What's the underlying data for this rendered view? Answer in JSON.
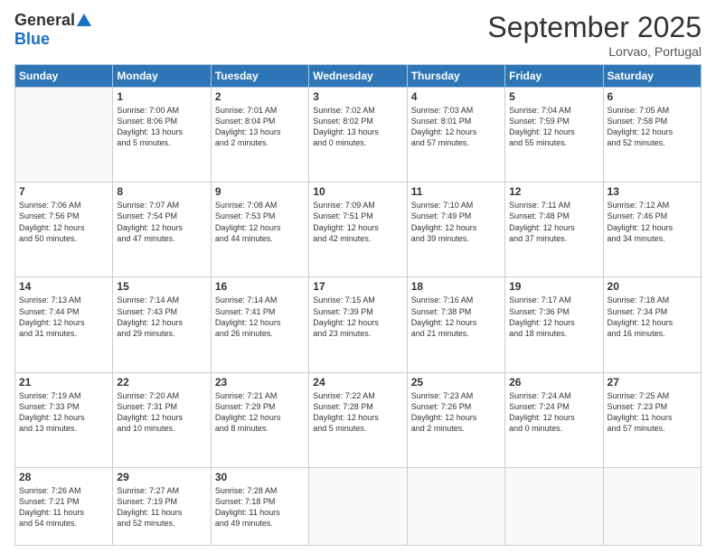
{
  "logo": {
    "general": "General",
    "blue": "Blue"
  },
  "title": "September 2025",
  "location": "Lorvao, Portugal",
  "days_header": [
    "Sunday",
    "Monday",
    "Tuesday",
    "Wednesday",
    "Thursday",
    "Friday",
    "Saturday"
  ],
  "weeks": [
    [
      {
        "day": "",
        "content": ""
      },
      {
        "day": "1",
        "content": "Sunrise: 7:00 AM\nSunset: 8:06 PM\nDaylight: 13 hours\nand 5 minutes."
      },
      {
        "day": "2",
        "content": "Sunrise: 7:01 AM\nSunset: 8:04 PM\nDaylight: 13 hours\nand 2 minutes."
      },
      {
        "day": "3",
        "content": "Sunrise: 7:02 AM\nSunset: 8:02 PM\nDaylight: 13 hours\nand 0 minutes."
      },
      {
        "day": "4",
        "content": "Sunrise: 7:03 AM\nSunset: 8:01 PM\nDaylight: 12 hours\nand 57 minutes."
      },
      {
        "day": "5",
        "content": "Sunrise: 7:04 AM\nSunset: 7:59 PM\nDaylight: 12 hours\nand 55 minutes."
      },
      {
        "day": "6",
        "content": "Sunrise: 7:05 AM\nSunset: 7:58 PM\nDaylight: 12 hours\nand 52 minutes."
      }
    ],
    [
      {
        "day": "7",
        "content": "Sunrise: 7:06 AM\nSunset: 7:56 PM\nDaylight: 12 hours\nand 50 minutes."
      },
      {
        "day": "8",
        "content": "Sunrise: 7:07 AM\nSunset: 7:54 PM\nDaylight: 12 hours\nand 47 minutes."
      },
      {
        "day": "9",
        "content": "Sunrise: 7:08 AM\nSunset: 7:53 PM\nDaylight: 12 hours\nand 44 minutes."
      },
      {
        "day": "10",
        "content": "Sunrise: 7:09 AM\nSunset: 7:51 PM\nDaylight: 12 hours\nand 42 minutes."
      },
      {
        "day": "11",
        "content": "Sunrise: 7:10 AM\nSunset: 7:49 PM\nDaylight: 12 hours\nand 39 minutes."
      },
      {
        "day": "12",
        "content": "Sunrise: 7:11 AM\nSunset: 7:48 PM\nDaylight: 12 hours\nand 37 minutes."
      },
      {
        "day": "13",
        "content": "Sunrise: 7:12 AM\nSunset: 7:46 PM\nDaylight: 12 hours\nand 34 minutes."
      }
    ],
    [
      {
        "day": "14",
        "content": "Sunrise: 7:13 AM\nSunset: 7:44 PM\nDaylight: 12 hours\nand 31 minutes."
      },
      {
        "day": "15",
        "content": "Sunrise: 7:14 AM\nSunset: 7:43 PM\nDaylight: 12 hours\nand 29 minutes."
      },
      {
        "day": "16",
        "content": "Sunrise: 7:14 AM\nSunset: 7:41 PM\nDaylight: 12 hours\nand 26 minutes."
      },
      {
        "day": "17",
        "content": "Sunrise: 7:15 AM\nSunset: 7:39 PM\nDaylight: 12 hours\nand 23 minutes."
      },
      {
        "day": "18",
        "content": "Sunrise: 7:16 AM\nSunset: 7:38 PM\nDaylight: 12 hours\nand 21 minutes."
      },
      {
        "day": "19",
        "content": "Sunrise: 7:17 AM\nSunset: 7:36 PM\nDaylight: 12 hours\nand 18 minutes."
      },
      {
        "day": "20",
        "content": "Sunrise: 7:18 AM\nSunset: 7:34 PM\nDaylight: 12 hours\nand 16 minutes."
      }
    ],
    [
      {
        "day": "21",
        "content": "Sunrise: 7:19 AM\nSunset: 7:33 PM\nDaylight: 12 hours\nand 13 minutes."
      },
      {
        "day": "22",
        "content": "Sunrise: 7:20 AM\nSunset: 7:31 PM\nDaylight: 12 hours\nand 10 minutes."
      },
      {
        "day": "23",
        "content": "Sunrise: 7:21 AM\nSunset: 7:29 PM\nDaylight: 12 hours\nand 8 minutes."
      },
      {
        "day": "24",
        "content": "Sunrise: 7:22 AM\nSunset: 7:28 PM\nDaylight: 12 hours\nand 5 minutes."
      },
      {
        "day": "25",
        "content": "Sunrise: 7:23 AM\nSunset: 7:26 PM\nDaylight: 12 hours\nand 2 minutes."
      },
      {
        "day": "26",
        "content": "Sunrise: 7:24 AM\nSunset: 7:24 PM\nDaylight: 12 hours\nand 0 minutes."
      },
      {
        "day": "27",
        "content": "Sunrise: 7:25 AM\nSunset: 7:23 PM\nDaylight: 11 hours\nand 57 minutes."
      }
    ],
    [
      {
        "day": "28",
        "content": "Sunrise: 7:26 AM\nSunset: 7:21 PM\nDaylight: 11 hours\nand 54 minutes."
      },
      {
        "day": "29",
        "content": "Sunrise: 7:27 AM\nSunset: 7:19 PM\nDaylight: 11 hours\nand 52 minutes."
      },
      {
        "day": "30",
        "content": "Sunrise: 7:28 AM\nSunset: 7:18 PM\nDaylight: 11 hours\nand 49 minutes."
      },
      {
        "day": "",
        "content": ""
      },
      {
        "day": "",
        "content": ""
      },
      {
        "day": "",
        "content": ""
      },
      {
        "day": "",
        "content": ""
      }
    ]
  ]
}
